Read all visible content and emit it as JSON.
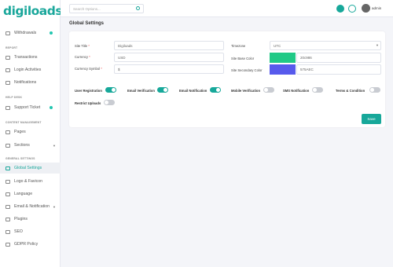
{
  "brand": {
    "logo_text": "digiloads",
    "logo_dot": "."
  },
  "sidebar": {
    "items": [
      {
        "label": "Withdrawals",
        "icon": "wallet-icon",
        "badge": true
      },
      {
        "section": "REPORT"
      },
      {
        "label": "Transactions",
        "icon": "list-icon"
      },
      {
        "label": "Login Activities",
        "icon": "clock-icon"
      },
      {
        "label": "Notifications",
        "icon": "bell-icon"
      },
      {
        "section": "HELP DESK"
      },
      {
        "label": "Support Ticket",
        "icon": "ticket-icon",
        "badge": true
      },
      {
        "section": "CONTENT MANAGEMENT"
      },
      {
        "label": "Pages",
        "icon": "file-icon"
      },
      {
        "label": "Sections",
        "icon": "grid-icon",
        "caret": true
      },
      {
        "section": "GENERAL SETTINGS"
      },
      {
        "label": "Global Settings",
        "icon": "gear-icon",
        "active": true
      },
      {
        "label": "Logo & Favicon",
        "icon": "image-icon"
      },
      {
        "label": "Language",
        "icon": "language-icon"
      },
      {
        "label": "Email & Notification",
        "icon": "mail-icon",
        "caret": true
      },
      {
        "label": "Plugins",
        "icon": "plug-icon"
      },
      {
        "label": "SEO",
        "icon": "seo-icon"
      },
      {
        "label": "GDPR Policy",
        "icon": "shield-icon"
      }
    ]
  },
  "topbar": {
    "search_placeholder": "Search Options...",
    "user_name": "admin"
  },
  "page": {
    "title": "Global Settings"
  },
  "form": {
    "site_title": {
      "label": "Site Title",
      "value": "Digiloads"
    },
    "currency": {
      "label": "Currency",
      "value": "USD"
    },
    "currency_symbol": {
      "label": "Currency Symbol",
      "value": "$"
    },
    "timezone": {
      "label": "Timezone",
      "value": "UTC"
    },
    "base_color": {
      "label": "Site Base Color",
      "value": "20c986",
      "color": "#20c986"
    },
    "secondary_color": {
      "label": "Site Secondary Color",
      "value": "575AEC",
      "color": "#575AEC"
    }
  },
  "toggles": [
    {
      "label": "User Registration",
      "on": true
    },
    {
      "label": "Email Verification",
      "on": true
    },
    {
      "label": "Email Notification",
      "on": true
    },
    {
      "label": "Mobile Verification",
      "on": false
    },
    {
      "label": "SMS Notification",
      "on": false
    },
    {
      "label": "Terms & Condition",
      "on": false
    },
    {
      "label": "Restrict Uploads",
      "on": false
    }
  ],
  "actions": {
    "save_label": "Save"
  },
  "colors": {
    "accent": "#17a89a"
  }
}
